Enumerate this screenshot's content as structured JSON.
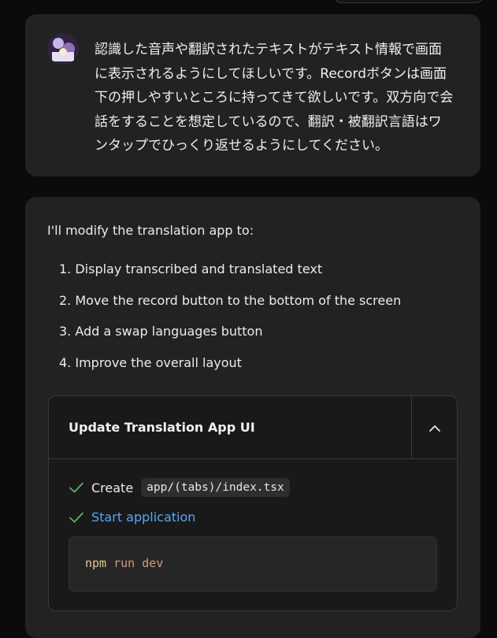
{
  "user_message": {
    "lines": [
      "認識した音声や翻訳されたテキストがテキスト情報で画面",
      "に表示されるようにしてほしいです。Recordボタンは画面",
      "下の押しやすいところに持ってきて欲しいです。双方向で会",
      "話をすることを想定しているので、翻訳・被翻訳言語はワ",
      "ンタップでひっくり返せるようにしてください。"
    ]
  },
  "assistant_message": {
    "intro": "I'll modify the translation app to:",
    "steps": [
      "1. Display transcribed and translated text",
      "2. Move the record button to the bottom of the screen",
      "3. Add a swap languages button",
      "4. Improve the overall layout"
    ],
    "artifact": {
      "title": "Update Translation App UI",
      "collapse_icon": "chevron-up-icon",
      "create_label": "Create",
      "create_file": "app/(tabs)/index.tsx",
      "start_label": "Start application",
      "command_name": "npm",
      "command_args": "run dev"
    }
  },
  "colors": {
    "background": "#0b0b0b",
    "card": "#222222",
    "link": "#5aa7ef",
    "check": "#5fb06a"
  }
}
